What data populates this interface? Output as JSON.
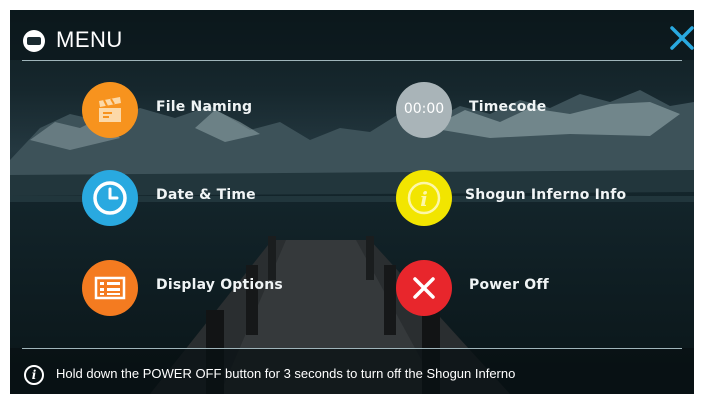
{
  "header": {
    "title": "MENU",
    "logo_icon": "atomos-logo-icon",
    "close_icon": "close-icon",
    "accent_color": "#29a9e0"
  },
  "menu_items": [
    {
      "label": "File Naming",
      "icon": "clapperboard-icon",
      "color": "#f7931e"
    },
    {
      "label": "Timecode",
      "icon": "timecode-icon",
      "icon_text": "00:00",
      "color": "#a9b4b8"
    },
    {
      "label": "Date & Time",
      "icon": "clock-icon",
      "color": "#29a9e0"
    },
    {
      "label": "Shogun Inferno Info",
      "icon": "info-icon",
      "color": "#f2e500"
    },
    {
      "label": "Display Options",
      "icon": "display-options-icon",
      "color": "#f47b20"
    },
    {
      "label": "Power Off",
      "icon": "power-off-icon",
      "color": "#e8262c"
    }
  ],
  "footer": {
    "info_text": "Hold down the POWER OFF button for 3 seconds to turn off the Shogun Inferno",
    "icon": "info-icon"
  }
}
